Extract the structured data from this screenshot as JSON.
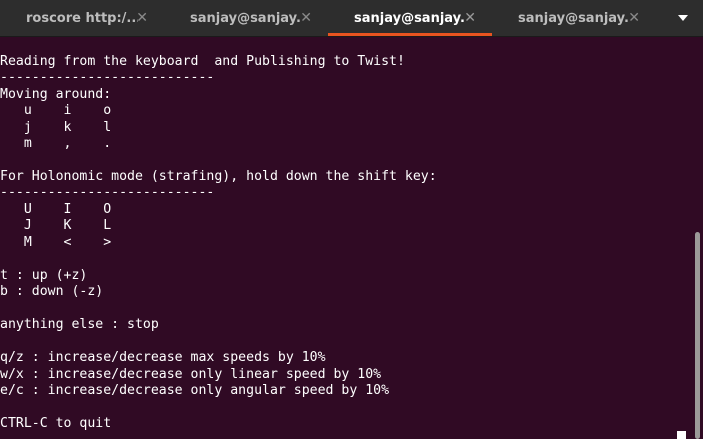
{
  "window": {
    "accent_color": "#e95420",
    "background_color": "#300a24"
  },
  "tabs": [
    {
      "label": "roscore http:/...",
      "active": false,
      "close_icon": "close-icon"
    },
    {
      "label": "sanjay@sanjay...",
      "active": false,
      "close_icon": "close-icon"
    },
    {
      "label": "sanjay@sanjay...",
      "active": true,
      "close_icon": "close-icon"
    },
    {
      "label": "sanjay@sanjay...",
      "active": false,
      "close_icon": "close-icon"
    }
  ],
  "menu_icon": "chevron-down-icon",
  "terminal": {
    "lines": [
      "Reading from the keyboard  and Publishing to Twist!",
      "---------------------------",
      "Moving around:",
      "   u    i    o",
      "   j    k    l",
      "   m    ,    .",
      "",
      "For Holonomic mode (strafing), hold down the shift key:",
      "---------------------------",
      "   U    I    O",
      "   J    K    L",
      "   M    <    >",
      "",
      "t : up (+z)",
      "b : down (-z)",
      "",
      "anything else : stop",
      "",
      "q/z : increase/decrease max speeds by 10%",
      "w/x : increase/decrease only linear speed by 10%",
      "e/c : increase/decrease only angular speed by 10%",
      "",
      "CTRL-C to quit"
    ]
  }
}
